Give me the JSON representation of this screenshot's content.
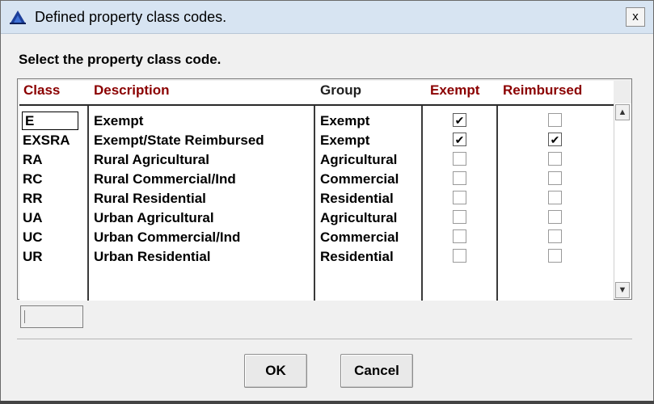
{
  "window": {
    "title": "Defined property class codes.",
    "close_label": "x"
  },
  "prompt": "Select the property class code.",
  "columns": [
    "Class",
    "Description",
    "Group",
    "Exempt",
    "Reimbursed"
  ],
  "rows": [
    {
      "class": "E",
      "description": "Exempt",
      "group": "Exempt",
      "exempt": true,
      "reimbursed": false
    },
    {
      "class": "EXSRA",
      "description": "Exempt/State Reimbursed",
      "group": "Exempt",
      "exempt": true,
      "reimbursed": true
    },
    {
      "class": "RA",
      "description": "Rural Agricultural",
      "group": "Agricultural",
      "exempt": false,
      "reimbursed": false
    },
    {
      "class": "RC",
      "description": "Rural Commercial/Ind",
      "group": "Commercial",
      "exempt": false,
      "reimbursed": false
    },
    {
      "class": "RR",
      "description": "Rural Residential",
      "group": "Residential",
      "exempt": false,
      "reimbursed": false
    },
    {
      "class": "UA",
      "description": "Urban Agricultural",
      "group": "Agricultural",
      "exempt": false,
      "reimbursed": false
    },
    {
      "class": "UC",
      "description": "Urban Commercial/Ind",
      "group": "Commercial",
      "exempt": false,
      "reimbursed": false
    },
    {
      "class": "UR",
      "description": "Urban Residential",
      "group": "Residential",
      "exempt": false,
      "reimbursed": false
    }
  ],
  "buttons": {
    "ok": "OK",
    "cancel": "Cancel"
  },
  "icons": {
    "app": "app-icon",
    "close": "close-icon",
    "scroll_up": "arrow-up-icon",
    "scroll_down": "arrow-down-icon"
  },
  "colors": {
    "header_text": "#8b0000",
    "titlebar": "#d7e4f2",
    "dialog_bg": "#f0f0f0"
  }
}
